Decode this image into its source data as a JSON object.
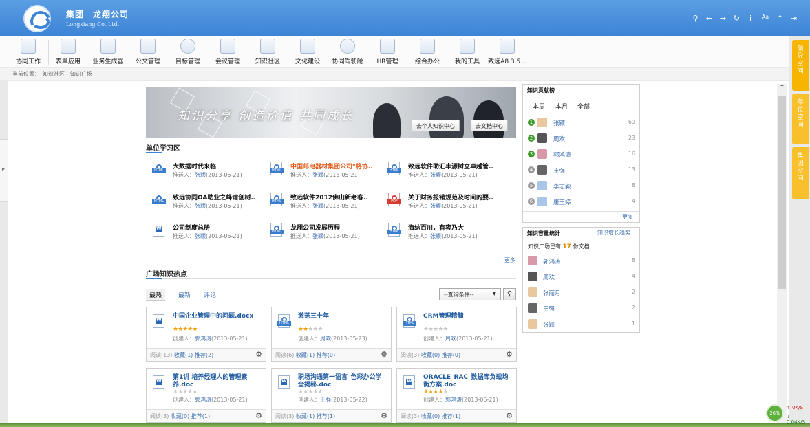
{
  "header": {
    "company": "集团　龙翔公司",
    "company_en": "Longxiang Co.,Ltd."
  },
  "toolbar": {
    "items": [
      "协同工作",
      "表单应用",
      "业务生成器",
      "公文管理",
      "目标管理",
      "会议管理",
      "知识社区",
      "文化建设",
      "协同驾驶舱",
      "HR管理",
      "综合办公",
      "我的工具",
      "致远A8 3.5..."
    ]
  },
  "breadcrumb": {
    "label": "当前位置：",
    "path": "知识社区 - 知识广场"
  },
  "side_tabs": [
    "领导空间",
    "单位空间",
    "集团空间"
  ],
  "banner": {
    "slogan": "知识分享 创造价值 共同成长",
    "btn_personal": "去个人知识中心",
    "btn_docs": "去文档中心"
  },
  "study": {
    "title": "单位学习区",
    "more": "更多",
    "items": [
      {
        "title": "大数据时代来临",
        "pusher_label": "推送人：",
        "pusher": "张颖",
        "date": "(2013-05-21)",
        "icon": "html-file-icon"
      },
      {
        "title": "中国邮电器材集团公司\"将协..",
        "pusher_label": "推送人：",
        "pusher": "张颖",
        "date": "(2013-05-21)",
        "icon": "html-file-icon"
      },
      {
        "title": "致远软件助汇丰源树立卓越管..",
        "pusher_label": "推送人：",
        "pusher": "张颖",
        "date": "(2013-05-21)",
        "icon": "html-file-icon"
      },
      {
        "title": "致远协同OA助业之峰谱创树..",
        "pusher_label": "推送人：",
        "pusher": "张颖",
        "date": "(2013-05-21)",
        "icon": "html-file-icon"
      },
      {
        "title": "致远软件2012佛山新老客..",
        "pusher_label": "推送人：",
        "pusher": "张颖",
        "date": "(2013-05-21)",
        "icon": "html-file-icon"
      },
      {
        "title": "关于财务报销规范及时间的要..",
        "pusher_label": "推送人：",
        "pusher": "张颖",
        "date": "(2013-05-21)",
        "icon": "pdf-file-icon"
      },
      {
        "title": "公司制度总册",
        "pusher_label": "推送人：",
        "pusher": "张颖",
        "date": "(2013-05-21)",
        "icon": "word-file-icon"
      },
      {
        "title": "龙翔公司发展历程",
        "pusher_label": "推送人：",
        "pusher": "张颖",
        "date": "(2013-05-21)",
        "icon": "html-file-icon"
      },
      {
        "title": "海纳百川，有容乃大",
        "pusher_label": "推送人：",
        "pusher": "张颖",
        "date": "(2013-05-21)",
        "icon": "html-file-icon"
      }
    ]
  },
  "hot": {
    "title": "广场知识热点",
    "tabs": [
      "最热",
      "最新",
      "评论"
    ],
    "query": "--查询条件--",
    "cards": [
      {
        "title": "中国企业管理中的问题.docx",
        "icon": "word-file-icon",
        "rating": 5,
        "creator_label": "创建人：",
        "creator": "郭鸿涛",
        "date": "(2013-05-21)",
        "read": "阅读(13)",
        "fav": "收藏(1)",
        "rec": "推荐(2)"
      },
      {
        "title": "激荡三十年",
        "icon": "html-file-icon",
        "rating": 2,
        "creator_label": "创建人：",
        "creator": "周欢",
        "date": "(2013-05-23)",
        "read": "阅读(6)",
        "fav": "收藏(1)",
        "rec": "推荐(0)"
      },
      {
        "title": "CRM管理精髓",
        "icon": "html-file-icon",
        "rating": 0,
        "creator_label": "创建人：",
        "creator": "周欢",
        "date": "(2013-05-21)",
        "read": "阅读(3)",
        "fav": "收藏(0)",
        "rec": "推荐(0)"
      },
      {
        "title": "第1讲 培养经理人的管理素养.doc",
        "icon": "word-file-icon",
        "rating": 0,
        "creator_label": "创建人：",
        "creator": "郭鸿涛",
        "date": "(2013-05-21)",
        "read": "阅读(3)",
        "fav": "收藏(0)",
        "rec": "推荐(1)"
      },
      {
        "title": "职场沟通第一语言_色彩办公学全揭秘.doc",
        "icon": "word-file-icon",
        "rating": 0,
        "creator_label": "创建人：",
        "creator": "王强",
        "date": "(2013-05-22)",
        "read": "阅读(3)",
        "fav": "收藏(1)",
        "rec": "推荐(1)"
      },
      {
        "title": "ORACLE_RAC_数据库负载均衡方案.doc",
        "icon": "word-file-icon",
        "rating": 4,
        "creator_label": "创建人：",
        "creator": "郭鸿涛",
        "date": "(2013-05-21)",
        "read": "阅读(3)",
        "fav": "收藏(0)",
        "rec": "推荐(1)"
      }
    ]
  },
  "contrib": {
    "title": "知识贡献榜",
    "tabs": [
      "本周",
      "本月",
      "全部"
    ],
    "more": "更多",
    "rows": [
      {
        "rank": "1",
        "name": "张颖",
        "count": "69",
        "color": "#3a9a27"
      },
      {
        "rank": "2",
        "name": "周欢",
        "count": "23",
        "color": "#3a9a27"
      },
      {
        "rank": "3",
        "name": "郭鸿涛",
        "count": "16",
        "color": "#3a9a27"
      },
      {
        "rank": "4",
        "name": "王强",
        "count": "13",
        "color": "#999999"
      },
      {
        "rank": "5",
        "name": "李志毅",
        "count": "8",
        "color": "#999999"
      },
      {
        "rank": "6",
        "name": "唐王婷",
        "count": "4",
        "color": "#999999"
      }
    ]
  },
  "stats": {
    "title": "知识容量统计",
    "trend": "知识增长趋势",
    "summary_pre": "知识广场已有",
    "summary_num": "17",
    "summary_post": "份文档",
    "rows": [
      {
        "name": "郭鸿涛",
        "count": "8"
      },
      {
        "name": "周欢",
        "count": "4"
      },
      {
        "name": "张丽月",
        "count": "2"
      },
      {
        "name": "王强",
        "count": "2"
      },
      {
        "name": "张颖",
        "count": "1"
      }
    ]
  },
  "net": {
    "percent": "26%",
    "up": "0K/S",
    "down": "0.04K/S"
  }
}
